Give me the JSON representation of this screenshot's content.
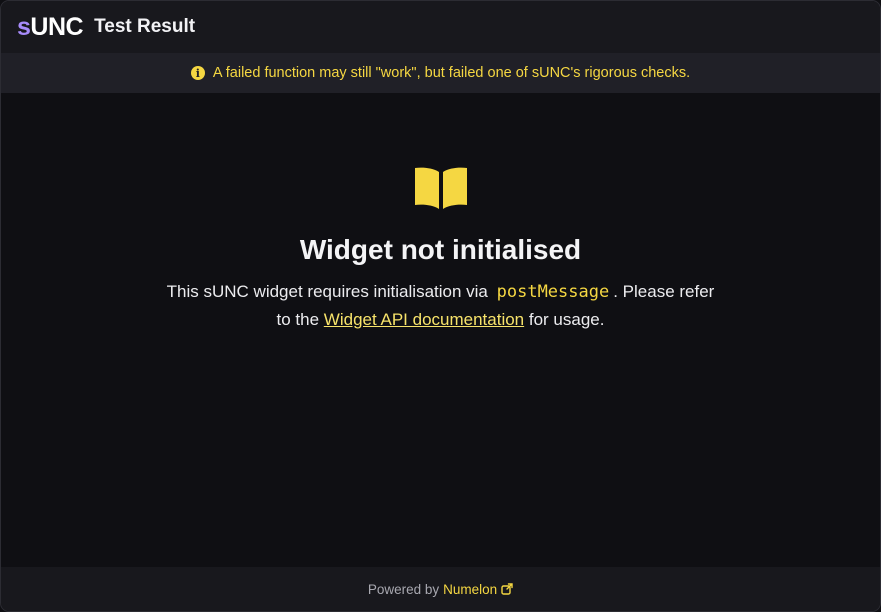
{
  "header": {
    "logo_prefix": "s",
    "logo_rest": "UNC",
    "title": "Test Result"
  },
  "notice": {
    "icon": "info-icon",
    "text": "A failed function may still \"work\", but failed one of sUNC's rigorous checks."
  },
  "main": {
    "icon": "book-open-icon",
    "heading": "Widget not initialised",
    "desc_part1": "This sUNC widget requires initialisation via",
    "code": "postMessage",
    "desc_part2": ". Please refer to the",
    "link_text": "Widget API documentation",
    "desc_part3": "for usage."
  },
  "footer": {
    "powered_by": "Powered by",
    "brand": "Numelon",
    "icon": "external-link-icon"
  },
  "colors": {
    "accent_yellow": "#f5d742",
    "logo_purple": "#a78bfa",
    "background": "#0f0f13",
    "header_bg": "#18181d"
  }
}
